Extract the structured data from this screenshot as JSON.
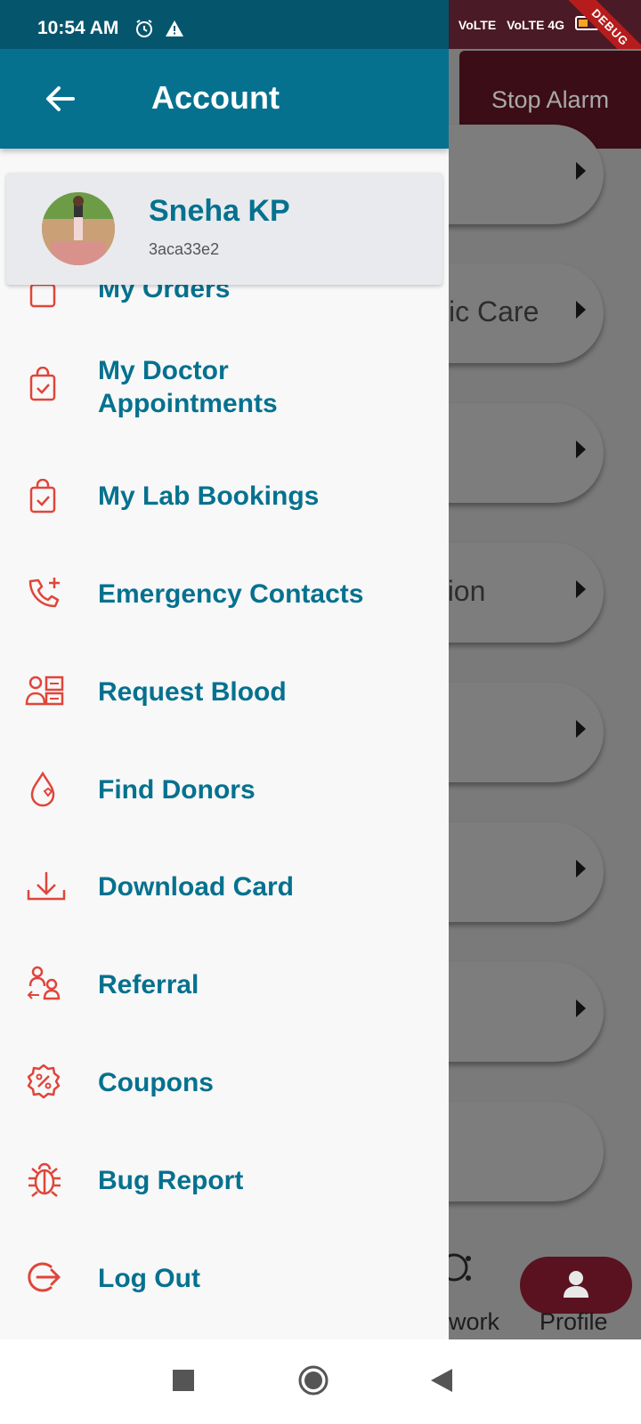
{
  "status_bar": {
    "time": "10:54 AM",
    "signal_1": "VoLTE",
    "signal_2": "VoLTE 4G",
    "debug_label": "DEBUG"
  },
  "background": {
    "stop_alarm": "Stop Alarm",
    "cards": [
      "",
      "ic Care",
      "",
      "ation",
      "",
      "",
      "",
      ""
    ],
    "nav_network": "work",
    "nav_profile": "Profile"
  },
  "header": {
    "title": "Account",
    "back_icon": "arrow-left-icon"
  },
  "profile": {
    "name": "Sneha KP",
    "id": "3aca33e2"
  },
  "menu": [
    {
      "label": "My Orders",
      "icon": "bag-icon"
    },
    {
      "label": "My Doctor Appointments",
      "line1": "My Doctor",
      "line2": "Appointments",
      "icon": "bag-check-icon"
    },
    {
      "label": "My Lab Bookings",
      "icon": "bag-check-icon"
    },
    {
      "label": "Emergency Contacts",
      "icon": "phone-plus-icon"
    },
    {
      "label": "Request Blood",
      "icon": "blood-request-icon"
    },
    {
      "label": "Find Donors",
      "icon": "blood-drop-icon"
    },
    {
      "label": "Download Card",
      "icon": "download-icon"
    },
    {
      "label": "Referral",
      "icon": "referral-icon"
    },
    {
      "label": "Coupons",
      "icon": "coupon-icon"
    },
    {
      "label": "Bug Report",
      "icon": "bug-icon"
    },
    {
      "label": "Log Out",
      "icon": "logout-icon"
    }
  ],
  "colors": {
    "primary": "#05718f",
    "accent": "#e0453a",
    "drawer_bg": "#f8f8f8"
  }
}
